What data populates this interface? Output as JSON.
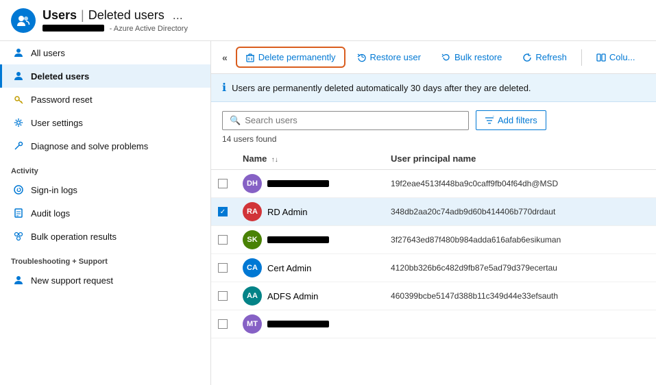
{
  "header": {
    "icon_label": "users-icon",
    "title_main": "Users",
    "separator": "|",
    "title_sub": "Deleted users",
    "dots": "...",
    "subtitle_prefix": "- Azure Active Directory"
  },
  "toolbar": {
    "collapse_label": "«",
    "delete_label": "Delete permanently",
    "restore_label": "Restore user",
    "bulk_restore_label": "Bulk restore",
    "refresh_label": "Refresh",
    "columns_label": "Colu..."
  },
  "sidebar": {
    "items": [
      {
        "id": "all-users",
        "label": "All users",
        "icon": "person"
      },
      {
        "id": "deleted-users",
        "label": "Deleted users",
        "icon": "person",
        "active": true
      },
      {
        "id": "password-reset",
        "label": "Password reset",
        "icon": "key"
      },
      {
        "id": "user-settings",
        "label": "User settings",
        "icon": "settings"
      },
      {
        "id": "diagnose",
        "label": "Diagnose and solve problems",
        "icon": "wrench"
      }
    ],
    "activity_label": "Activity",
    "activity_items": [
      {
        "id": "sign-in-logs",
        "label": "Sign-in logs",
        "icon": "signin"
      },
      {
        "id": "audit-logs",
        "label": "Audit logs",
        "icon": "audit"
      },
      {
        "id": "bulk-op",
        "label": "Bulk operation results",
        "icon": "bulk"
      }
    ],
    "troubleshooting_label": "Troubleshooting + Support",
    "troubleshooting_items": [
      {
        "id": "support",
        "label": "New support request",
        "icon": "support"
      }
    ]
  },
  "banner": {
    "text": "Users are permanently deleted automatically 30 days after they are deleted."
  },
  "search": {
    "placeholder": "Search users",
    "add_filters_label": "Add filters"
  },
  "users_found": "14 users found",
  "table": {
    "col_name": "Name",
    "col_upn": "User principal name",
    "rows": [
      {
        "id": "row-dh",
        "initials": "DH",
        "avatar_color": "#8661c5",
        "name_hidden": true,
        "name": "",
        "upn": "19f2eae4513f448ba9c0caff9fb04f64dh@MSD",
        "checked": false,
        "selected": false
      },
      {
        "id": "row-ra",
        "initials": "RA",
        "avatar_color": "#d13438",
        "name_hidden": false,
        "name": "RD Admin",
        "upn": "348db2aa20c74adb9d60b414406b770drdaut",
        "checked": true,
        "selected": true
      },
      {
        "id": "row-sk",
        "initials": "SK",
        "avatar_color": "#498205",
        "name_hidden": true,
        "name": "",
        "upn": "3f27643ed87f480b984adda616afab6esikuman",
        "checked": false,
        "selected": false
      },
      {
        "id": "row-ca",
        "initials": "CA",
        "avatar_color": "#0078d4",
        "name_hidden": false,
        "name": "Cert Admin",
        "upn": "4120bb326b6c482d9fb87e5ad79d379ecertau",
        "checked": false,
        "selected": false
      },
      {
        "id": "row-aa",
        "initials": "AA",
        "avatar_color": "#038387",
        "name_hidden": false,
        "name": "ADFS Admin",
        "upn": "460399bcbe5147d388b11c349d44e33efsauth",
        "checked": false,
        "selected": false
      },
      {
        "id": "row-mt",
        "initials": "MT",
        "avatar_color": "#8661c5",
        "name_hidden": true,
        "name": "",
        "upn": "",
        "checked": false,
        "selected": false
      }
    ]
  },
  "colors": {
    "accent": "#0078d4",
    "active_sidebar_bg": "#e6f2fb",
    "selected_row_bg": "#e6f2fb"
  }
}
